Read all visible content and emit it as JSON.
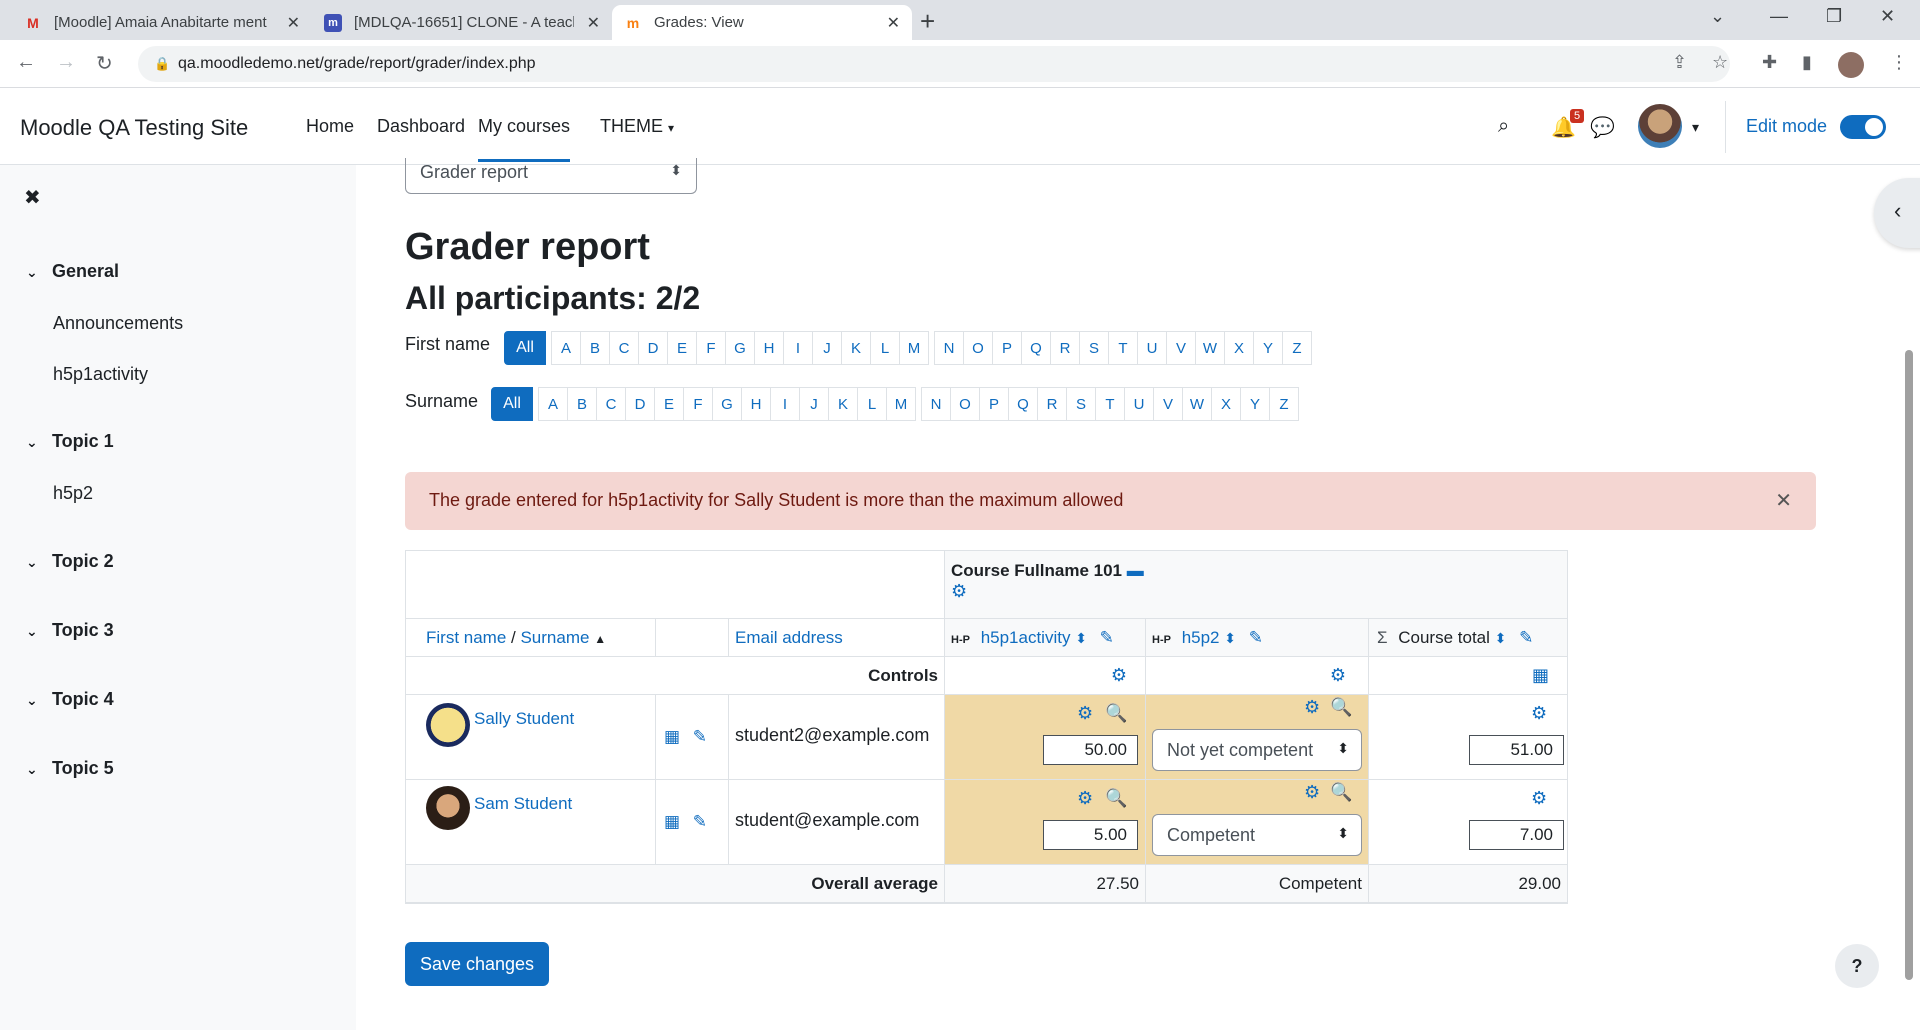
{
  "browser": {
    "tabs": [
      {
        "title": "[Moodle] Amaia Anabitarte ment",
        "icon": "gmail-icon"
      },
      {
        "title": "[MDLQA-16651] CLONE - A teach",
        "icon": "jira-icon"
      },
      {
        "title": "Grades: View",
        "icon": "moodle-icon"
      }
    ],
    "url": "qa.moodledemo.net/grade/report/grader/index.php"
  },
  "navbar": {
    "site_name": "Moodle QA Testing Site",
    "links": [
      "Home",
      "Dashboard",
      "My courses",
      "THEME"
    ],
    "notification_count": "5",
    "edit_mode_label": "Edit mode"
  },
  "drawer": {
    "sections": [
      {
        "title": "General",
        "items": [
          "Announcements",
          "h5p1activity"
        ]
      },
      {
        "title": "Topic 1",
        "items": [
          "h5p2"
        ]
      },
      {
        "title": "Topic 2",
        "items": []
      },
      {
        "title": "Topic 3",
        "items": []
      },
      {
        "title": "Topic 4",
        "items": []
      },
      {
        "title": "Topic 5",
        "items": []
      }
    ]
  },
  "report_select": "Grader report",
  "heading": "Grader report",
  "participants": "All participants: 2/2",
  "initials": {
    "first_label": "First name",
    "surname_label": "Surname",
    "all": "All",
    "letters": [
      "A",
      "B",
      "C",
      "D",
      "E",
      "F",
      "G",
      "H",
      "I",
      "J",
      "K",
      "L",
      "M",
      "N",
      "O",
      "P",
      "Q",
      "R",
      "S",
      "T",
      "U",
      "V",
      "W",
      "X",
      "Y",
      "Z"
    ]
  },
  "alert": "The grade entered for h5p1activity for Sally Student is more than the maximum allowed",
  "table": {
    "course_name": "Course Fullname 101",
    "col_firstname": "First name",
    "col_sep": " / ",
    "col_surname": "Surname",
    "col_email": "Email address",
    "col_h5p1": "h5p1activity",
    "col_h5p2": "h5p2",
    "col_total": "Course total",
    "h5p_badge": "H-P",
    "controls": "Controls",
    "rows": [
      {
        "name": "Sally Student",
        "email": "student2@example.com",
        "h5p1": "50.00",
        "h5p2": "Not yet competent",
        "total": "51.00"
      },
      {
        "name": "Sam Student",
        "email": "student@example.com",
        "h5p1": "5.00",
        "h5p2": "Competent",
        "total": "7.00"
      }
    ],
    "overall_label": "Overall average",
    "avg_h5p1": "27.50",
    "avg_h5p2": "Competent",
    "avg_total": "29.00"
  },
  "save_label": "Save changes",
  "help_label": "?"
}
